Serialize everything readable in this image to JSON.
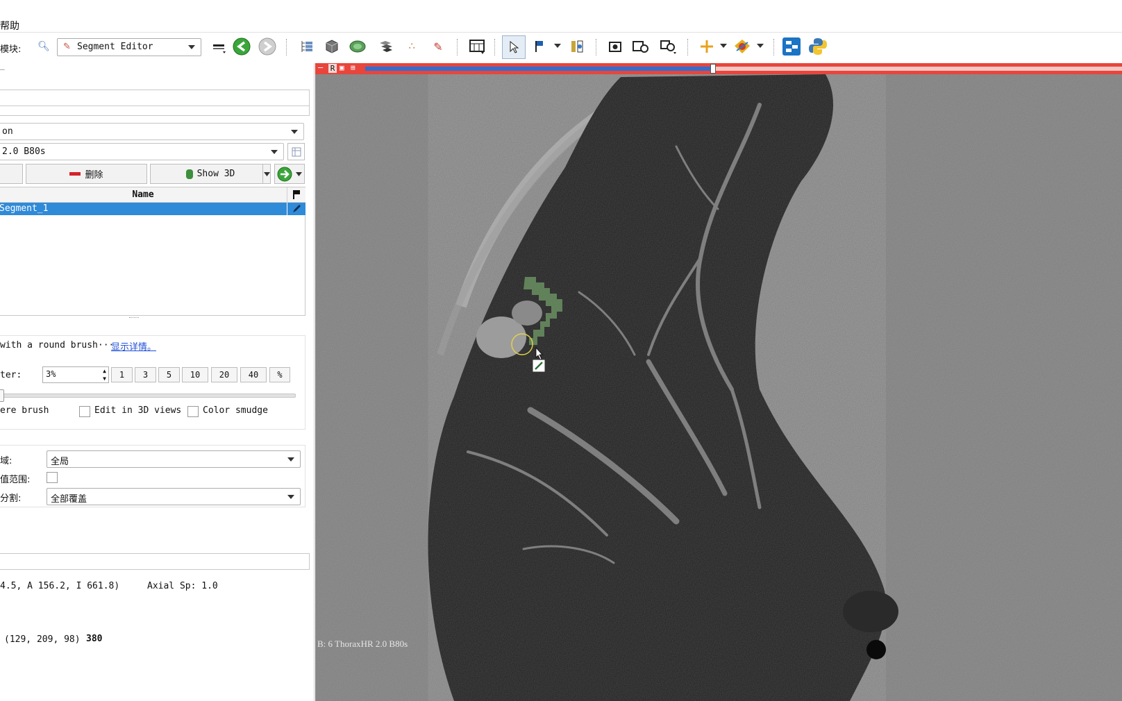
{
  "menu": {
    "help": "帮助"
  },
  "toolbar": {
    "module_label": "模块:",
    "module_value": "Segment Editor",
    "icons": [
      "search-icon",
      "module-icon",
      "back-icon",
      "forward-icon",
      "data-icon",
      "volumes-icon",
      "models-icon",
      "transforms-icon",
      "markups-icon",
      "editor-icon",
      "layout-icon",
      "select-icon",
      "fiducial-icon",
      "crosshair-link-icon",
      "screenshot-icon",
      "capture-icon",
      "scene-view-icon",
      "crosshair-icon",
      "mouse-mode-icon",
      "extensions-icon",
      "python-icon"
    ]
  },
  "segment_editor": {
    "segmentation_value": "on",
    "master_volume_value": "2.0  B80s",
    "delete_label": "删除",
    "show3d_label": "Show 3D",
    "table_header": "Name",
    "segments": [
      {
        "name": "Segment_1",
        "color": "#2f8ad8"
      }
    ]
  },
  "effect": {
    "description": "with a round brush···",
    "details_link": "显示详情。",
    "diameter_label": "ter:",
    "diameter_value": "3%",
    "presets": [
      "1",
      "3",
      "5",
      "10",
      "20",
      "40",
      "%"
    ],
    "sphere_label": "ere brush",
    "edit3d_label": "Edit in 3D views",
    "color_smudge_label": "Color smudge"
  },
  "masking": {
    "area_label": "域:",
    "area_value": "全局",
    "threshold_label": "值范围:",
    "overwrite_label": "分割:",
    "overwrite_value": "全部覆盖"
  },
  "status": {
    "ras_text": "4.5, A 156.2, I 661.8)",
    "axial_text": "Axial Sp: 1.0",
    "ijk_text": "(129, 209,  98)",
    "value": "380"
  },
  "viewer": {
    "slice_label": "R",
    "corner_annotation": "B: 6 ThoraxHR  2.0  B80s",
    "slice_offset_fraction": 0.46
  },
  "colors": {
    "selection_blue": "#2f8ad8",
    "slice_red": "#e8453c",
    "segment_green": "#6a8f62",
    "link_blue": "#1f4fd8"
  }
}
